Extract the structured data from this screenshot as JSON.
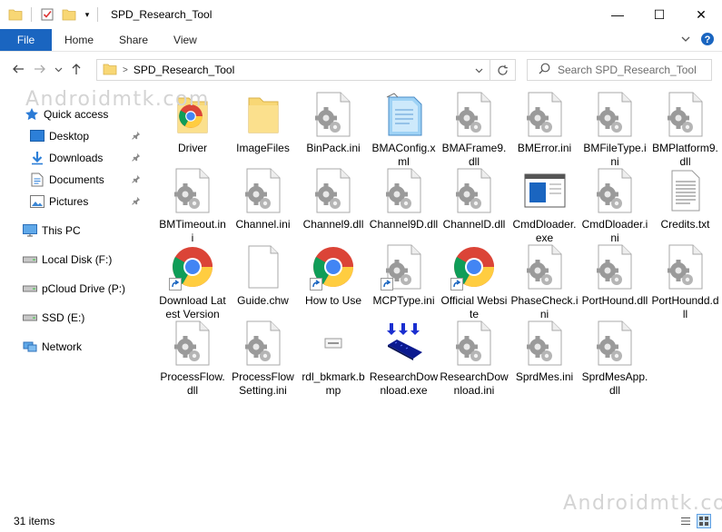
{
  "window": {
    "title": "SPD_Research_Tool",
    "controls": {
      "minimize": "—",
      "maximize": "☐",
      "close": "✕"
    }
  },
  "ribbon": {
    "tabs": [
      "File",
      "Home",
      "Share",
      "View"
    ],
    "collapse_icon": "chevron-down-icon",
    "help_icon": "help-icon",
    "file_tab_color": "#1a65c0"
  },
  "address": {
    "path": "SPD_Research_Tool",
    "search_placeholder": "Search SPD_Research_Tool"
  },
  "sidebar": {
    "quick_access": "Quick access",
    "pinned": [
      {
        "label": "Desktop",
        "icon": "desktop-icon"
      },
      {
        "label": "Downloads",
        "icon": "downloads-icon"
      },
      {
        "label": "Documents",
        "icon": "documents-icon"
      },
      {
        "label": "Pictures",
        "icon": "pictures-icon"
      }
    ],
    "this_pc": "This PC",
    "drives": [
      {
        "label": "Local Disk (F:)",
        "icon": "drive-icon"
      },
      {
        "label": "pCloud Drive (P:)",
        "icon": "drive-icon"
      },
      {
        "label": "SSD (E:)",
        "icon": "drive-icon"
      }
    ],
    "network": "Network"
  },
  "files": [
    {
      "name": "Driver",
      "icon": "chrome-folder"
    },
    {
      "name": "ImageFiles",
      "icon": "folder"
    },
    {
      "name": "BinPack.ini",
      "icon": "settings-file"
    },
    {
      "name": "BMAConfig.xml",
      "icon": "notepad"
    },
    {
      "name": "BMAFrame9.dll",
      "icon": "settings-file"
    },
    {
      "name": "BMError.ini",
      "icon": "settings-file"
    },
    {
      "name": "BMFileType.ini",
      "icon": "settings-file"
    },
    {
      "name": "BMPlatform9.dll",
      "icon": "settings-file"
    },
    {
      "name": "BMTimeout.ini",
      "icon": "settings-file"
    },
    {
      "name": "Channel.ini",
      "icon": "settings-file"
    },
    {
      "name": "Channel9.dll",
      "icon": "settings-file"
    },
    {
      "name": "Channel9D.dll",
      "icon": "settings-file"
    },
    {
      "name": "ChannelD.dll",
      "icon": "settings-file"
    },
    {
      "name": "CmdDloader.exe",
      "icon": "exe-window"
    },
    {
      "name": "CmdDloader.ini",
      "icon": "settings-file"
    },
    {
      "name": "Credits.txt",
      "icon": "text-file"
    },
    {
      "name": "Download Latest Version",
      "icon": "chrome-shortcut"
    },
    {
      "name": "Guide.chw",
      "icon": "blank-file"
    },
    {
      "name": "How to Use",
      "icon": "chrome-shortcut"
    },
    {
      "name": "MCPType.ini",
      "icon": "settings-shortcut"
    },
    {
      "name": "Official Website",
      "icon": "chrome-shortcut"
    },
    {
      "name": "PhaseCheck.ini",
      "icon": "settings-file"
    },
    {
      "name": "PortHound.dll",
      "icon": "settings-file"
    },
    {
      "name": "PortHoundd.dll",
      "icon": "settings-file"
    },
    {
      "name": "ProcessFlow.dll",
      "icon": "settings-file"
    },
    {
      "name": "ProcessFlowSetting.ini",
      "icon": "settings-file"
    },
    {
      "name": "rdl_bkmark.bmp",
      "icon": "bmp-thumb"
    },
    {
      "name": "ResearchDownload.exe",
      "icon": "research-exe"
    },
    {
      "name": "ResearchDownload.ini",
      "icon": "settings-file"
    },
    {
      "name": "SprdMes.ini",
      "icon": "settings-file"
    },
    {
      "name": "SprdMesApp.dll",
      "icon": "settings-file"
    }
  ],
  "status": {
    "count": "31 items"
  },
  "watermarks": [
    "Androidmtk.com",
    "Androidmtk.com"
  ]
}
